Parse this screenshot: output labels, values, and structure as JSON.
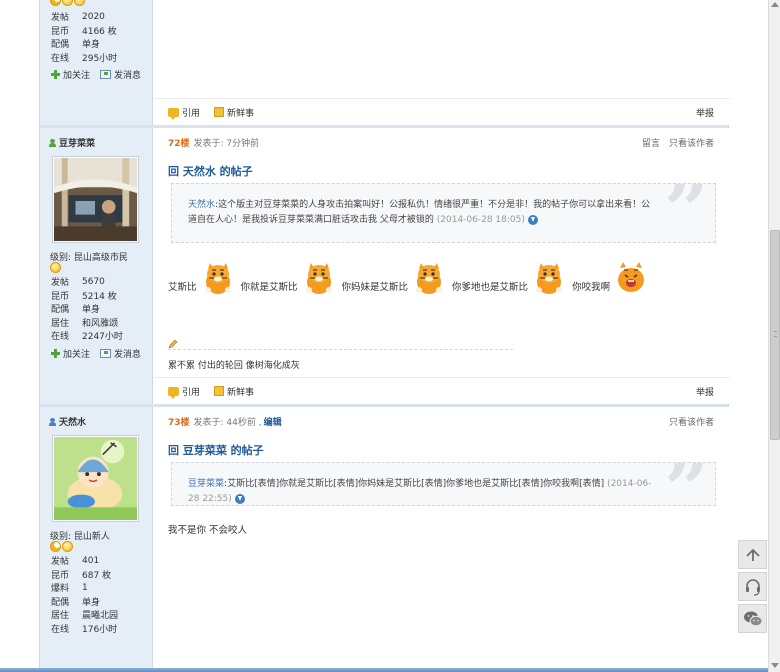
{
  "posts": [
    {
      "user": {
        "badges": [
          "moon",
          "star",
          "star"
        ],
        "stats": [
          {
            "k": "发帖",
            "v": "2020"
          },
          {
            "k": "昆币",
            "v": "4166 枚"
          },
          {
            "k": "配偶",
            "v": "单身"
          },
          {
            "k": "在线",
            "v": "295小时"
          }
        ],
        "follow_label": "加关注",
        "message_label": "发消息"
      },
      "footer": {
        "quote_label": "引用",
        "news_label": "新鲜事",
        "report_label": "举报"
      }
    },
    {
      "floor": "72楼",
      "posted": "发表于: 7分钟前",
      "meta_links": [
        "留言",
        "只看该作者"
      ],
      "title": "回 天然水 的帖子",
      "user": {
        "name": "豆芽菜菜",
        "level": "级别: 昆山高级市民",
        "badges": [
          "smile"
        ],
        "stats": [
          {
            "k": "发帖",
            "v": "5670"
          },
          {
            "k": "昆币",
            "v": "5214 枚"
          },
          {
            "k": "配偶",
            "v": "单身"
          },
          {
            "k": "居住",
            "v": "和风雅颂"
          },
          {
            "k": "在线",
            "v": "2247小时"
          }
        ],
        "follow_label": "加关注",
        "message_label": "发消息"
      },
      "quote": {
        "user": "天然水",
        "text": "这个版主对豆芽菜菜的人身攻击拍案叫好！公报私仇！情绪很严重！不分是非！我的帖子你可以拿出来看！公道自在人心！是我投诉豆芽菜菜满口脏话攻击我 父母才被锁的",
        "time": "(2014-06-28 18:05)"
      },
      "content": [
        "艾斯比",
        "你就是艾斯比",
        "你妈妹是艾斯比",
        "你爹地也是艾斯比",
        "你咬我啊"
      ],
      "signature": "累不累 付出的轮回 像树海化成灰",
      "footer": {
        "quote_label": "引用",
        "news_label": "新鲜事",
        "report_label": "举报"
      }
    },
    {
      "floor": "73楼",
      "posted": "发表于: 44秒前 ,",
      "edit_label": "编辑",
      "meta_links": [
        "只看该作者"
      ],
      "title": "回 豆芽菜菜 的帖子",
      "user": {
        "name": "天然水",
        "level": "级别: 昆山新人",
        "badges": [
          "moon",
          "star"
        ],
        "stats": [
          {
            "k": "发帖",
            "v": "401"
          },
          {
            "k": "昆币",
            "v": "687 枚"
          },
          {
            "k": "爆料",
            "v": "1"
          },
          {
            "k": "配偶",
            "v": "单身"
          },
          {
            "k": "居住",
            "v": "晨曦北园"
          },
          {
            "k": "在线",
            "v": "176小时"
          }
        ]
      },
      "quote": {
        "user": "豆芽菜菜",
        "text": "艾斯比[表情]你就是艾斯比[表情]你妈妹是艾斯比[表情]你爹地也是艾斯比[表情]你咬我啊[表情]",
        "time": "(2014-06-28 22:55)"
      },
      "content_text": "我不是你 不会咬人"
    }
  ],
  "float_buttons": [
    "back-to-top-icon",
    "customer-service-icon",
    "wechat-icon"
  ],
  "colors": {
    "sidebar": "#e5edf6",
    "title": "#1f5a9a",
    "floor": "#e06a17",
    "link": "#3a72b4"
  }
}
